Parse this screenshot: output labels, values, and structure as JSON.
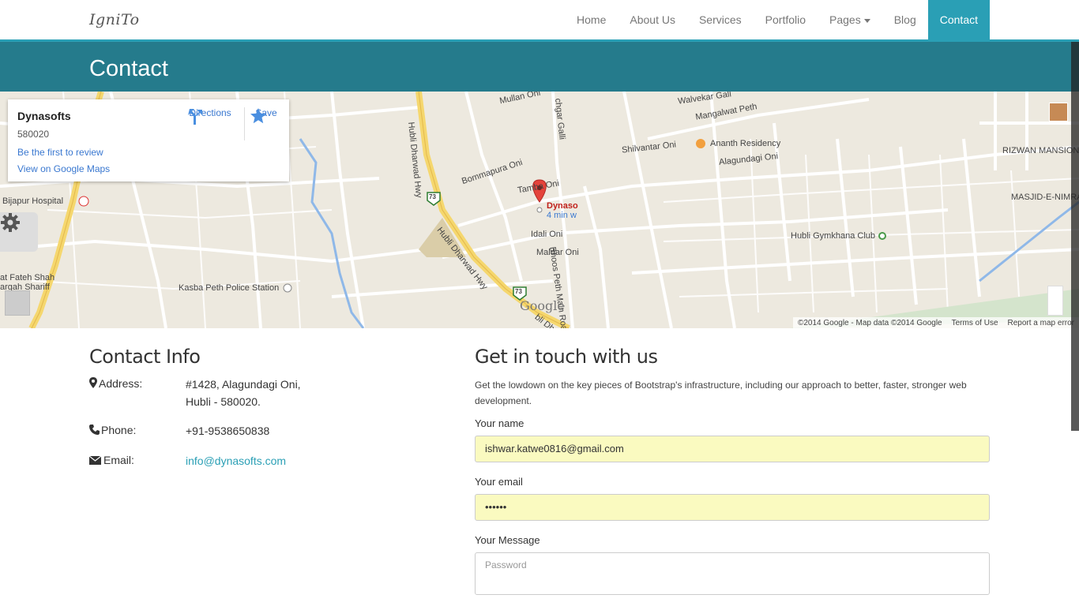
{
  "brand": "IgniTo",
  "nav": {
    "items": [
      "Home",
      "About Us",
      "Services",
      "Portfolio",
      "Pages",
      "Blog",
      "Contact"
    ],
    "active": "Contact"
  },
  "page_title": "Contact",
  "map": {
    "card": {
      "name": "Dynasofts",
      "zip": "580020",
      "review_link": "Be the first to review",
      "view_link": "View on Google Maps",
      "directions": "Directions",
      "save": "Save"
    },
    "labels": {
      "mullan": "Mullan Oni",
      "walvekar": "Walvekar Gall",
      "mangalwat": "Mangalwat Peth",
      "shilvantar": "Shilvantar Oni",
      "ananth": "Ananth Residency",
      "alagundagi": "Alagundagi Oni",
      "rizwan": "RIZWAN MANSION",
      "masjid": "MASJID-E-NIMRA",
      "bommapura": "Bommapura Oni",
      "tamba": "Tamba Oni",
      "marker": "Dynaso",
      "marker_sub": "4 min w",
      "idali": "Idali Oni",
      "maldar": "Maldar Oni",
      "bhoos": "Bhoos Peth Main Road",
      "gymkhana": "Hubli Gymkhana Club",
      "bijapur": "Bijapur Hospital",
      "fateh": "at Fateh Shah",
      "dargah": "argah Shariff",
      "kasba": "Kasba Peth Police Station",
      "hwy1": "Hubli Dharwad Hwy",
      "hwy2": "Hubli Dharwad Hwy",
      "hwy3": "bli Dh",
      "chargalli": "chgar Galli",
      "shield": "73",
      "google": "Google"
    },
    "footer": {
      "copyright": "©2014 Google - Map data ©2014 Google",
      "terms": "Terms of Use",
      "report": "Report a map error"
    }
  },
  "contact_info": {
    "heading": "Contact Info",
    "address_label": "Address:",
    "address_line1": "#1428, Alagundagi Oni,",
    "address_line2": "Hubli - 580020.",
    "phone_label": "Phone:",
    "phone": "+91-9538650838",
    "email_label": "Email:",
    "email": "info@dynasofts.com"
  },
  "get_in_touch": {
    "heading": "Get in touch with us",
    "intro": "Get the lowdown on the key pieces of Bootstrap's infrastructure, including our approach to better, faster, stronger web development.",
    "name_label": "Your name",
    "name_value": "ishwar.katwe0816@gmail.com",
    "email_label": "Your email",
    "email_value": "••••••",
    "message_label": "Your Message",
    "message_placeholder": "Password"
  },
  "colors": {
    "accent": "#2a9fb5",
    "title_bar": "#257b8c",
    "autofill": "#fafac0"
  }
}
